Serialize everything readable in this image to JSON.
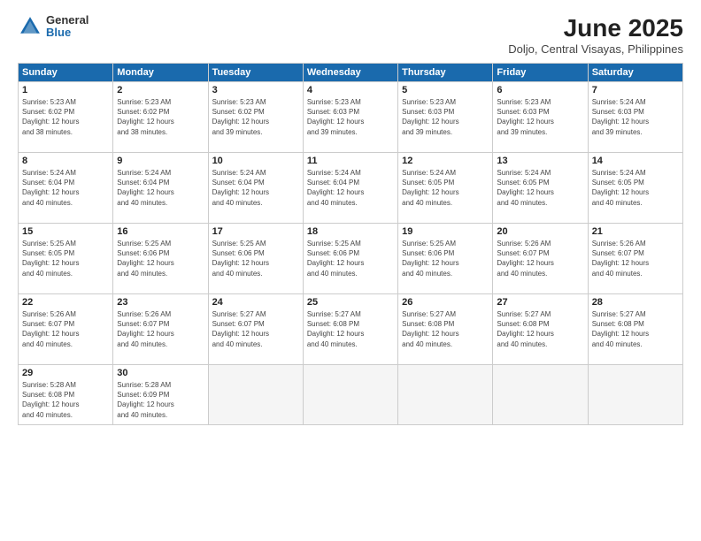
{
  "logo": {
    "general": "General",
    "blue": "Blue"
  },
  "header": {
    "month": "June 2025",
    "location": "Doljo, Central Visayas, Philippines"
  },
  "weekdays": [
    "Sunday",
    "Monday",
    "Tuesday",
    "Wednesday",
    "Thursday",
    "Friday",
    "Saturday"
  ],
  "days": [
    {
      "num": "",
      "info": ""
    },
    {
      "num": "",
      "info": ""
    },
    {
      "num": "",
      "info": ""
    },
    {
      "num": "",
      "info": ""
    },
    {
      "num": "",
      "info": ""
    },
    {
      "num": "",
      "info": ""
    },
    {
      "num": "1",
      "info": "Sunrise: 5:23 AM\nSunset: 6:02 PM\nDaylight: 12 hours\nand 38 minutes."
    },
    {
      "num": "2",
      "info": "Sunrise: 5:23 AM\nSunset: 6:02 PM\nDaylight: 12 hours\nand 38 minutes."
    },
    {
      "num": "3",
      "info": "Sunrise: 5:23 AM\nSunset: 6:02 PM\nDaylight: 12 hours\nand 39 minutes."
    },
    {
      "num": "4",
      "info": "Sunrise: 5:23 AM\nSunset: 6:03 PM\nDaylight: 12 hours\nand 39 minutes."
    },
    {
      "num": "5",
      "info": "Sunrise: 5:23 AM\nSunset: 6:03 PM\nDaylight: 12 hours\nand 39 minutes."
    },
    {
      "num": "6",
      "info": "Sunrise: 5:23 AM\nSunset: 6:03 PM\nDaylight: 12 hours\nand 39 minutes."
    },
    {
      "num": "7",
      "info": "Sunrise: 5:24 AM\nSunset: 6:03 PM\nDaylight: 12 hours\nand 39 minutes."
    },
    {
      "num": "8",
      "info": "Sunrise: 5:24 AM\nSunset: 6:04 PM\nDaylight: 12 hours\nand 40 minutes."
    },
    {
      "num": "9",
      "info": "Sunrise: 5:24 AM\nSunset: 6:04 PM\nDaylight: 12 hours\nand 40 minutes."
    },
    {
      "num": "10",
      "info": "Sunrise: 5:24 AM\nSunset: 6:04 PM\nDaylight: 12 hours\nand 40 minutes."
    },
    {
      "num": "11",
      "info": "Sunrise: 5:24 AM\nSunset: 6:04 PM\nDaylight: 12 hours\nand 40 minutes."
    },
    {
      "num": "12",
      "info": "Sunrise: 5:24 AM\nSunset: 6:05 PM\nDaylight: 12 hours\nand 40 minutes."
    },
    {
      "num": "13",
      "info": "Sunrise: 5:24 AM\nSunset: 6:05 PM\nDaylight: 12 hours\nand 40 minutes."
    },
    {
      "num": "14",
      "info": "Sunrise: 5:24 AM\nSunset: 6:05 PM\nDaylight: 12 hours\nand 40 minutes."
    },
    {
      "num": "15",
      "info": "Sunrise: 5:25 AM\nSunset: 6:05 PM\nDaylight: 12 hours\nand 40 minutes."
    },
    {
      "num": "16",
      "info": "Sunrise: 5:25 AM\nSunset: 6:06 PM\nDaylight: 12 hours\nand 40 minutes."
    },
    {
      "num": "17",
      "info": "Sunrise: 5:25 AM\nSunset: 6:06 PM\nDaylight: 12 hours\nand 40 minutes."
    },
    {
      "num": "18",
      "info": "Sunrise: 5:25 AM\nSunset: 6:06 PM\nDaylight: 12 hours\nand 40 minutes."
    },
    {
      "num": "19",
      "info": "Sunrise: 5:25 AM\nSunset: 6:06 PM\nDaylight: 12 hours\nand 40 minutes."
    },
    {
      "num": "20",
      "info": "Sunrise: 5:26 AM\nSunset: 6:07 PM\nDaylight: 12 hours\nand 40 minutes."
    },
    {
      "num": "21",
      "info": "Sunrise: 5:26 AM\nSunset: 6:07 PM\nDaylight: 12 hours\nand 40 minutes."
    },
    {
      "num": "22",
      "info": "Sunrise: 5:26 AM\nSunset: 6:07 PM\nDaylight: 12 hours\nand 40 minutes."
    },
    {
      "num": "23",
      "info": "Sunrise: 5:26 AM\nSunset: 6:07 PM\nDaylight: 12 hours\nand 40 minutes."
    },
    {
      "num": "24",
      "info": "Sunrise: 5:27 AM\nSunset: 6:07 PM\nDaylight: 12 hours\nand 40 minutes."
    },
    {
      "num": "25",
      "info": "Sunrise: 5:27 AM\nSunset: 6:08 PM\nDaylight: 12 hours\nand 40 minutes."
    },
    {
      "num": "26",
      "info": "Sunrise: 5:27 AM\nSunset: 6:08 PM\nDaylight: 12 hours\nand 40 minutes."
    },
    {
      "num": "27",
      "info": "Sunrise: 5:27 AM\nSunset: 6:08 PM\nDaylight: 12 hours\nand 40 minutes."
    },
    {
      "num": "28",
      "info": "Sunrise: 5:27 AM\nSunset: 6:08 PM\nDaylight: 12 hours\nand 40 minutes."
    },
    {
      "num": "29",
      "info": "Sunrise: 5:28 AM\nSunset: 6:08 PM\nDaylight: 12 hours\nand 40 minutes."
    },
    {
      "num": "30",
      "info": "Sunrise: 5:28 AM\nSunset: 6:09 PM\nDaylight: 12 hours\nand 40 minutes."
    },
    {
      "num": "",
      "info": ""
    },
    {
      "num": "",
      "info": ""
    },
    {
      "num": "",
      "info": ""
    },
    {
      "num": "",
      "info": ""
    },
    {
      "num": "",
      "info": ""
    }
  ]
}
